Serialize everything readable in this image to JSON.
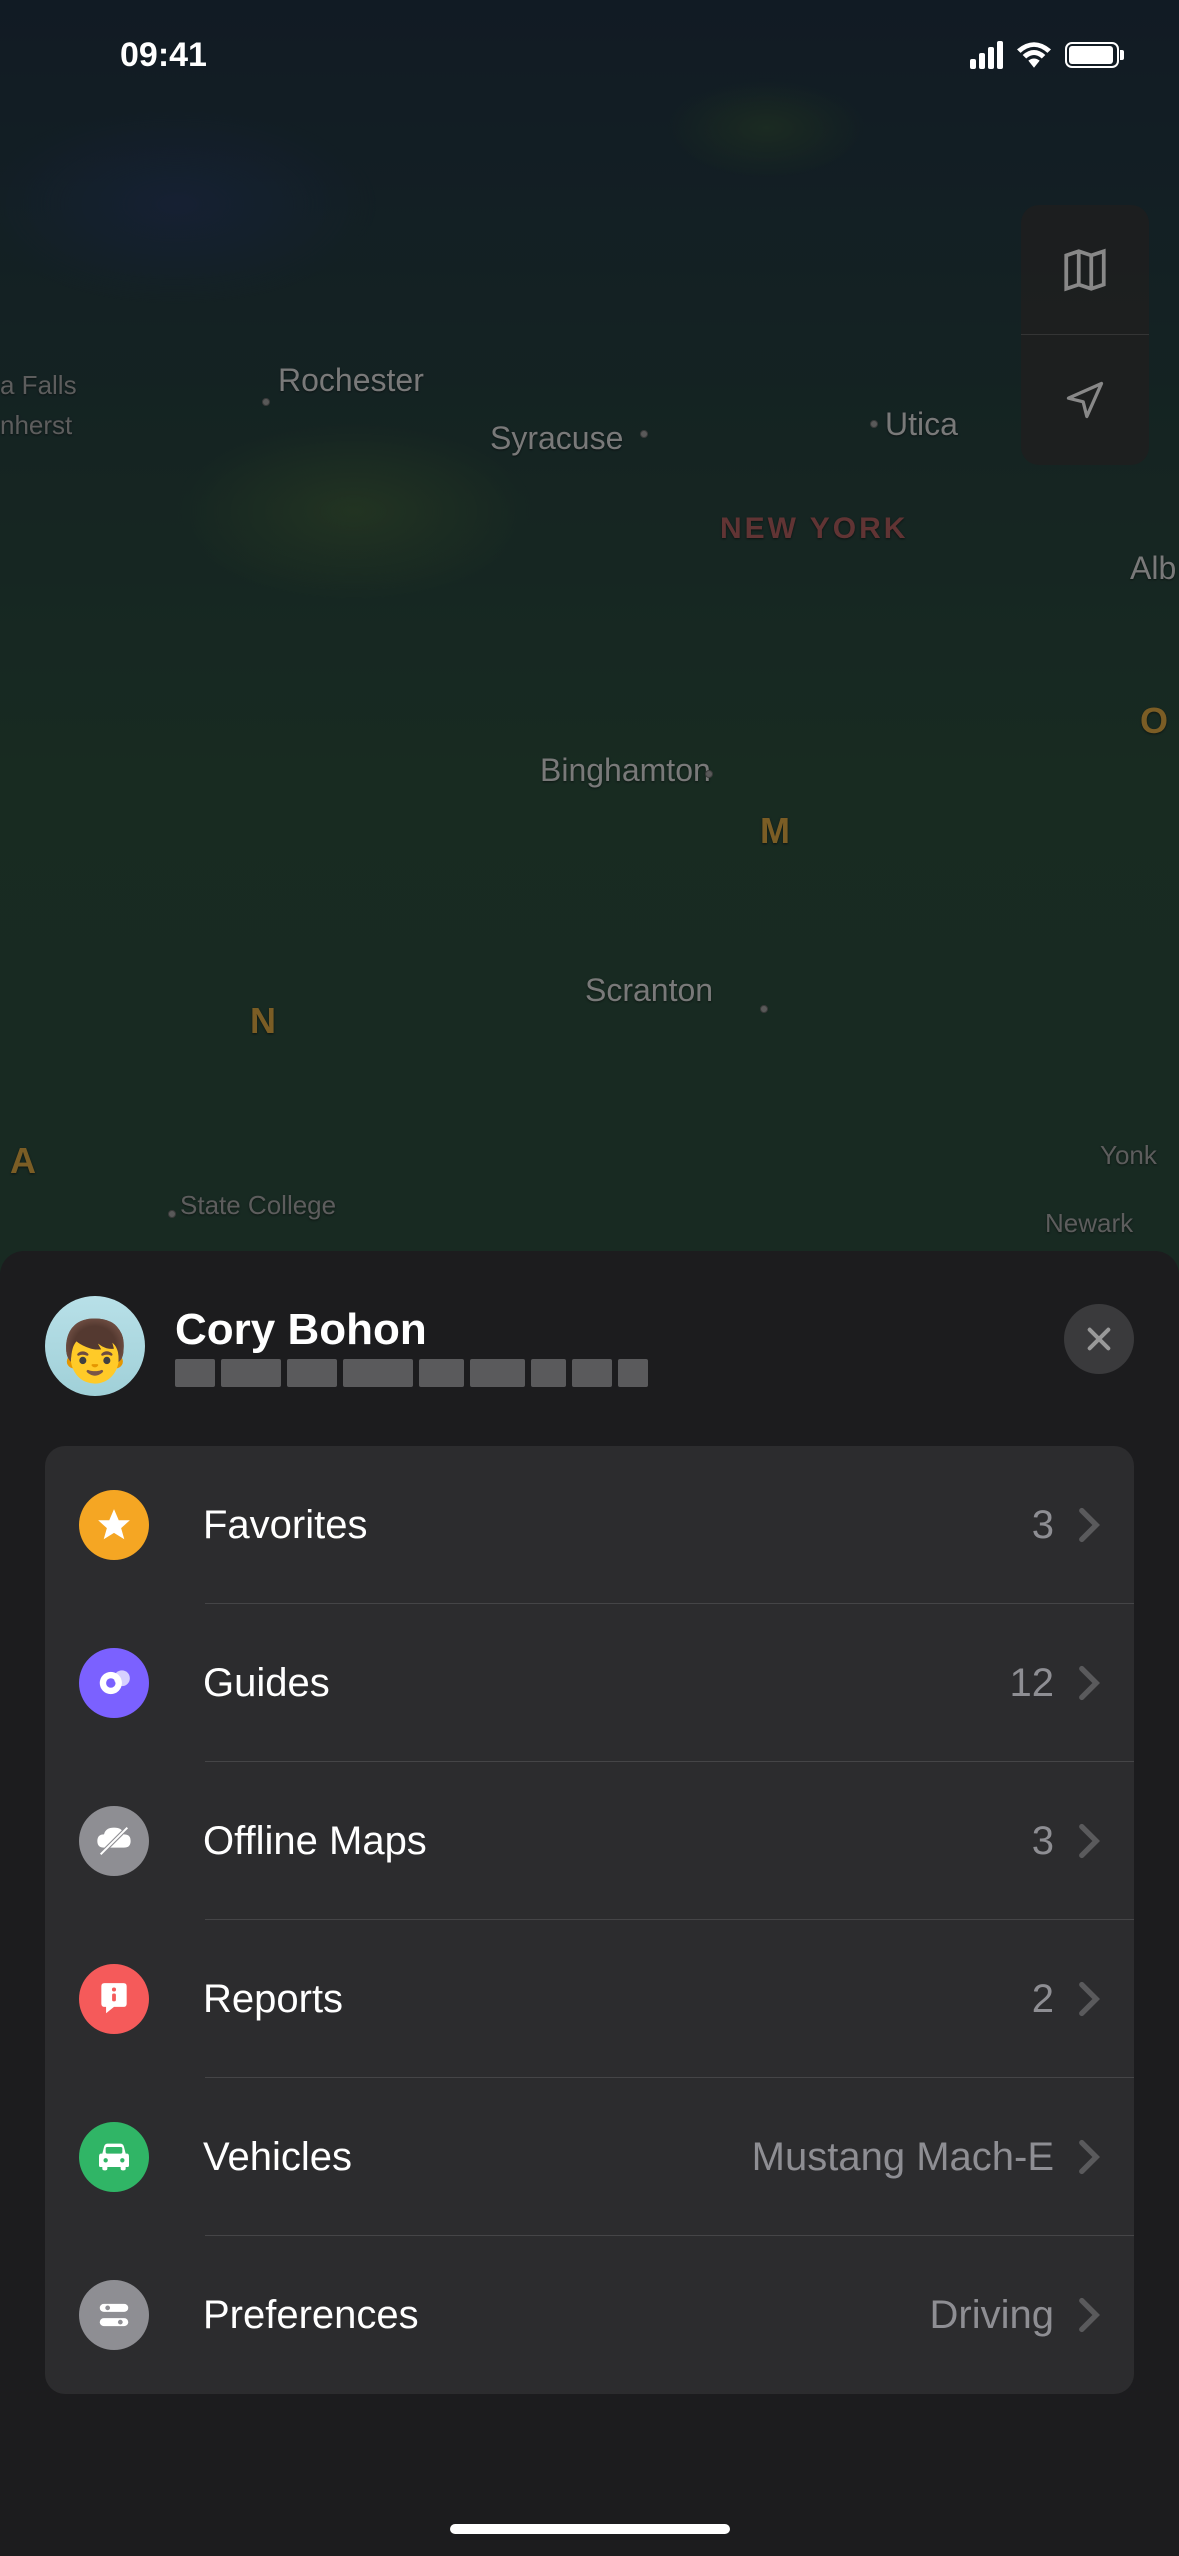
{
  "status_bar": {
    "time": "09:41"
  },
  "map": {
    "labels": {
      "rochester": "Rochester",
      "syracuse": "Syracuse",
      "utica": "Utica",
      "falls": "a Falls",
      "amherst": "nherst",
      "new_york": "NEW YORK",
      "albany": "Alb",
      "binghamton": "Binghamton",
      "scranton": "Scranton",
      "state_college": "State College",
      "newark": "Newark",
      "yonkers": "Yonk",
      "route_m": "M",
      "route_n": "N",
      "route_o": "O",
      "route_a": "A"
    }
  },
  "profile": {
    "name": "Cory Bohon"
  },
  "menu": {
    "items": [
      {
        "label": "Favorites",
        "value": "3"
      },
      {
        "label": "Guides",
        "value": "12"
      },
      {
        "label": "Offline Maps",
        "value": "3"
      },
      {
        "label": "Reports",
        "value": "2"
      },
      {
        "label": "Vehicles",
        "value": "Mustang Mach-E"
      },
      {
        "label": "Preferences",
        "value": "Driving"
      }
    ]
  }
}
